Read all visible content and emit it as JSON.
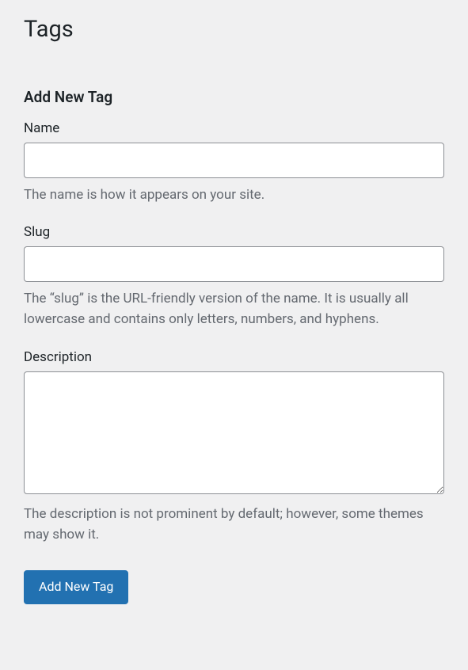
{
  "page": {
    "title": "Tags"
  },
  "form": {
    "heading": "Add New Tag",
    "name": {
      "label": "Name",
      "value": "",
      "description": "The name is how it appears on your site."
    },
    "slug": {
      "label": "Slug",
      "value": "",
      "description": "The “slug” is the URL-friendly version of the name. It is usually all lowercase and contains only letters, numbers, and hyphens."
    },
    "description": {
      "label": "Description",
      "value": "",
      "description": "The description is not prominent by default; however, some themes may show it."
    },
    "submit": {
      "label": "Add New Tag"
    }
  }
}
